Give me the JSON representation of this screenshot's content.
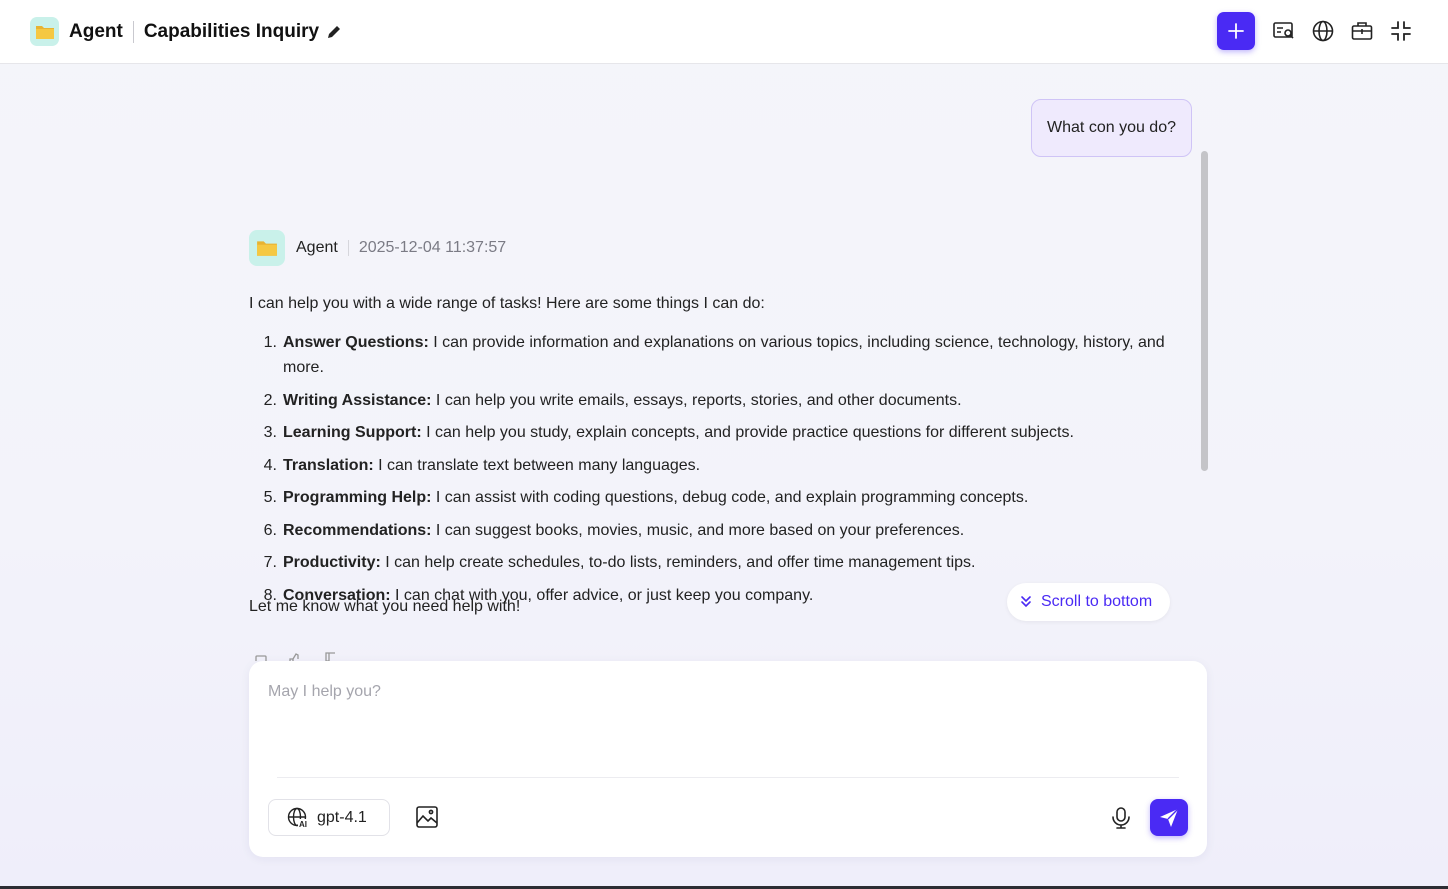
{
  "header": {
    "app_name": "Agent",
    "chat_title": "Capabilities Inquiry",
    "icons": [
      "folder-icon",
      "edit-pencil-icon",
      "plus-icon",
      "search-doc-icon",
      "globe-icon",
      "toolbox-icon",
      "collapse-icon"
    ],
    "accent_color": "#4a2af4"
  },
  "conversation": {
    "user_message": "What con you do?",
    "agent": {
      "name": "Agent",
      "timestamp": "2025-12-04 11:37:57",
      "intro": "I can help you with a wide range of tasks! Here are some things I can do:",
      "capabilities": [
        {
          "num": "1.",
          "title": "Answer Questions:",
          "text": " I can provide information and explanations on various topics, including science, technology, history, and more."
        },
        {
          "num": "2.",
          "title": "Writing Assistance:",
          "text": " I can help you write emails, essays, reports, stories, and other documents."
        },
        {
          "num": "3.",
          "title": "Learning Support:",
          "text": " I can help you study, explain concepts, and provide practice questions for different subjects."
        },
        {
          "num": "4.",
          "title": "Translation:",
          "text": " I can translate text between many languages."
        },
        {
          "num": "5.",
          "title": "Programming Help:",
          "text": " I can assist with coding questions, debug code, and explain programming concepts."
        },
        {
          "num": "6.",
          "title": "Recommendations:",
          "text": " I can suggest books, movies, music, and more based on your preferences."
        },
        {
          "num": "7.",
          "title": "Productivity:",
          "text": " I can help create schedules, to-do lists, reminders, and offer time management tips."
        },
        {
          "num": "8.",
          "title": "Conversation:",
          "text": " I can chat with you, offer advice, or just keep you company."
        }
      ],
      "outro": "Let me know what you need help with!"
    },
    "scroll_to_bottom_label": "Scroll to bottom"
  },
  "composer": {
    "placeholder": "May I help you?",
    "model": "gpt-4.1"
  }
}
